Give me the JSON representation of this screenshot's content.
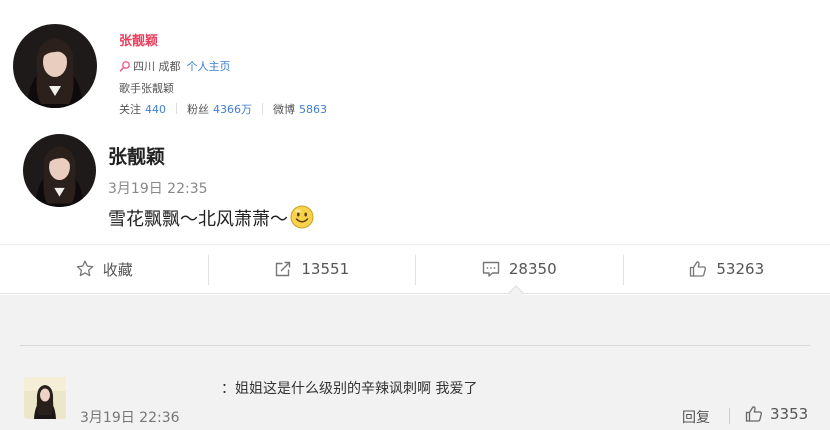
{
  "profile": {
    "name": "张靓颖",
    "location": "四川 成都",
    "homepage_link": "个人主页",
    "bio": "歌手张靓颖",
    "stats": [
      {
        "label": "关注",
        "value": "440"
      },
      {
        "label": "粉丝",
        "value": "4366万"
      },
      {
        "label": "微博",
        "value": "5863"
      }
    ]
  },
  "post": {
    "author": "张靓颖",
    "time": "3月19日 22:35",
    "text": "雪花飘飘～北风萧萧～",
    "emoji": "smiley-emoji"
  },
  "actions": [
    {
      "icon": "star-icon",
      "label": "收藏"
    },
    {
      "icon": "repost-icon",
      "label": "13551"
    },
    {
      "icon": "comment-icon",
      "label": "28350"
    },
    {
      "icon": "thumbs-up-icon",
      "label": "53263"
    }
  ],
  "comment": {
    "text": "：姐姐这是什么级别的辛辣讽刺啊 我爱了",
    "time": "3月19日 22:36",
    "reply_label": "回复",
    "likes": "3353"
  },
  "colors": {
    "name_red": "#eb3f5e",
    "link_blue": "#3f7fd1",
    "comment_bg": "#f2f2f2"
  }
}
